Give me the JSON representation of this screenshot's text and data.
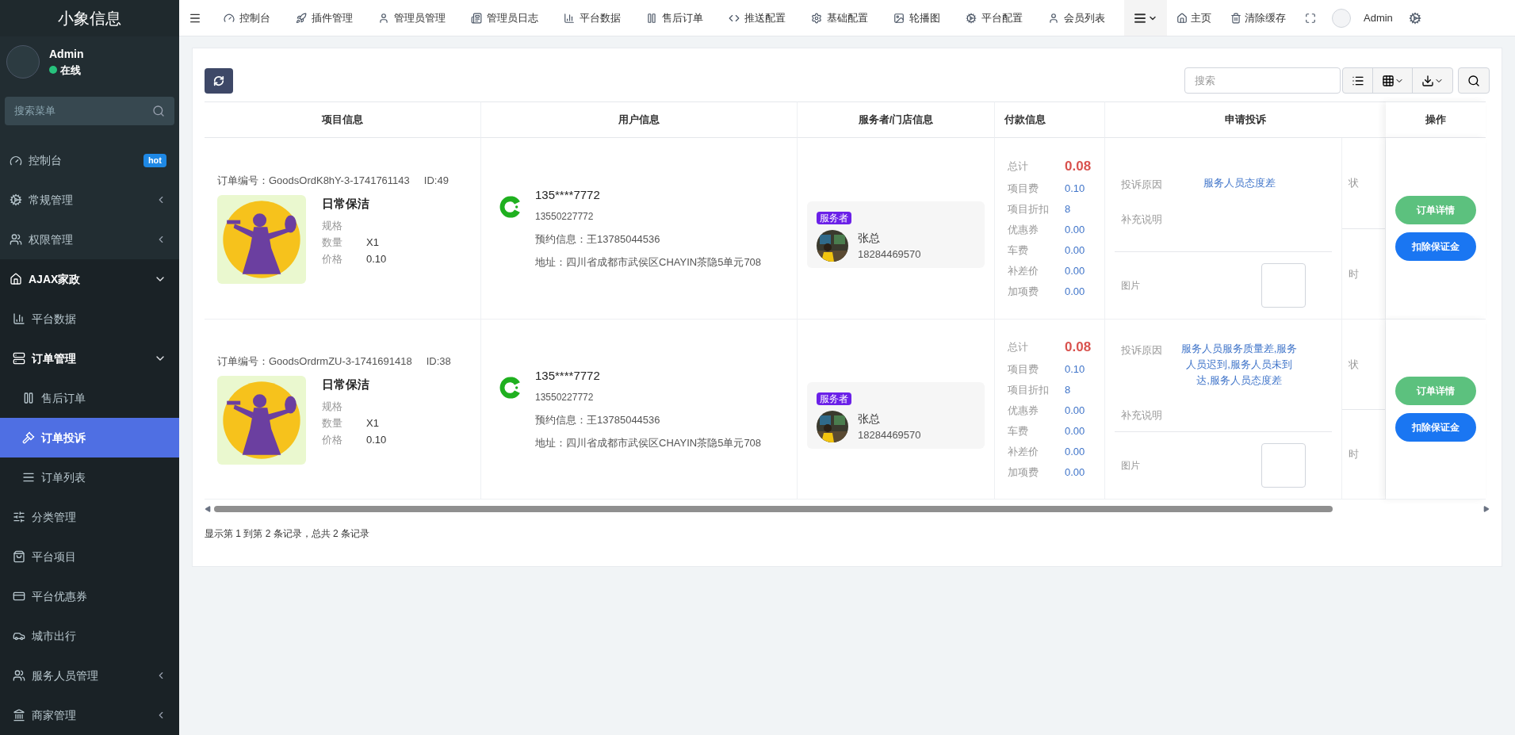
{
  "sidebar": {
    "logo": "小象信息",
    "user": {
      "name": "Admin",
      "status": "在线"
    },
    "search": {
      "placeholder": "搜索菜单"
    },
    "menu": [
      {
        "label": "控制台",
        "badge": "hot"
      },
      {
        "label": "常规管理",
        "expanded": false
      },
      {
        "label": "权限管理",
        "expanded": false
      },
      {
        "label": "AJAX家政",
        "expanded": true,
        "children": [
          {
            "label": "平台数据",
            "selected": false
          },
          {
            "label": "订单管理",
            "expanded": true,
            "children": [
              {
                "label": "售后订单",
                "selected": false
              },
              {
                "label": "订单投诉",
                "selected": true
              },
              {
                "label": "订单列表",
                "selected": false
              }
            ]
          },
          {
            "label": "分类管理",
            "selected": false
          },
          {
            "label": "平台项目",
            "selected": false
          },
          {
            "label": "平台优惠券",
            "selected": false
          },
          {
            "label": "城市出行",
            "selected": false
          },
          {
            "label": "服务人员管理",
            "expanded": false
          },
          {
            "label": "商家管理",
            "expanded": false
          }
        ]
      }
    ]
  },
  "topbar": {
    "items": [
      {
        "label": "控制台"
      },
      {
        "label": "插件管理"
      },
      {
        "label": "管理员管理"
      },
      {
        "label": "管理员日志"
      },
      {
        "label": "平台数据"
      },
      {
        "label": "售后订单"
      },
      {
        "label": "推送配置"
      },
      {
        "label": "基础配置"
      },
      {
        "label": "轮播图"
      },
      {
        "label": "平台配置"
      },
      {
        "label": "会员列表"
      }
    ],
    "right": [
      {
        "label": "主页"
      },
      {
        "label": "清除缓存"
      }
    ],
    "user": "Admin"
  },
  "toolbar": {
    "search": {
      "placeholder": "搜索"
    }
  },
  "table": {
    "columns": [
      "项目信息",
      "用户信息",
      "服务者/门店信息",
      "付款信息",
      "申请投诉",
      "操作"
    ],
    "rows": [
      {
        "order_no": "订单编号：GoodsOrdK8hY-3-1741761143",
        "id": "ID:49",
        "product": "日常保洁",
        "specs": [
          {
            "label": "规格"
          },
          {
            "label": "数量",
            "value": "X1"
          },
          {
            "label": "价格",
            "value": "0.10"
          }
        ],
        "user": {
          "masked_phone": "135****7772",
          "phone": "13550227772",
          "booking": "预约信息：王13785044536",
          "address": "地址：四川省成都市武侯区CHAYIN茶隐5单元708"
        },
        "server": {
          "tag": "服务者",
          "name": "张总",
          "phone": "18284469570"
        },
        "payment": {
          "total_label": "总计",
          "total": "0.08",
          "items": [
            {
              "label": "项目费",
              "value": "0.10"
            },
            {
              "label": "项目折扣",
              "value": "8"
            },
            {
              "label": "优惠券",
              "value": "0.00"
            },
            {
              "label": "车费",
              "value": "0.00"
            },
            {
              "label": "补差价",
              "value": "0.00"
            },
            {
              "label": "加项费",
              "value": "0.00"
            }
          ]
        },
        "complaint": {
          "reason_label": "投诉原因",
          "reason": "服务人员态度差",
          "note_label": "补充说明",
          "image_label": "图片"
        },
        "column_6": [
          "状",
          "时"
        ],
        "actions": [
          "订单详情",
          "扣除保证金"
        ]
      },
      {
        "order_no": "订单编号：GoodsOrdrmZU-3-1741691418",
        "id": "ID:38",
        "product": "日常保洁",
        "specs": [
          {
            "label": "规格"
          },
          {
            "label": "数量",
            "value": "X1"
          },
          {
            "label": "价格",
            "value": "0.10"
          }
        ],
        "user": {
          "masked_phone": "135****7772",
          "phone": "13550227772",
          "booking": "预约信息：王13785044536",
          "address": "地址：四川省成都市武侯区CHAYIN茶隐5单元708"
        },
        "server": {
          "tag": "服务者",
          "name": "张总",
          "phone": "18284469570"
        },
        "payment": {
          "total_label": "总计",
          "total": "0.08",
          "items": [
            {
              "label": "项目费",
              "value": "0.10"
            },
            {
              "label": "项目折扣",
              "value": "8"
            },
            {
              "label": "优惠券",
              "value": "0.00"
            },
            {
              "label": "车费",
              "value": "0.00"
            },
            {
              "label": "补差价",
              "value": "0.00"
            },
            {
              "label": "加项费",
              "value": "0.00"
            }
          ]
        },
        "complaint": {
          "reason_label": "投诉原因",
          "reason": "服务人员服务质量差,服务人员迟到,服务人员未到达,服务人员态度差",
          "note_label": "补充说明",
          "image_label": "图片"
        },
        "column_6": [
          "状",
          "时"
        ],
        "actions": [
          "订单详情",
          "扣除保证金"
        ]
      }
    ]
  },
  "footer": "显示第 1 到第 2 条记录，总共 2 条记录"
}
